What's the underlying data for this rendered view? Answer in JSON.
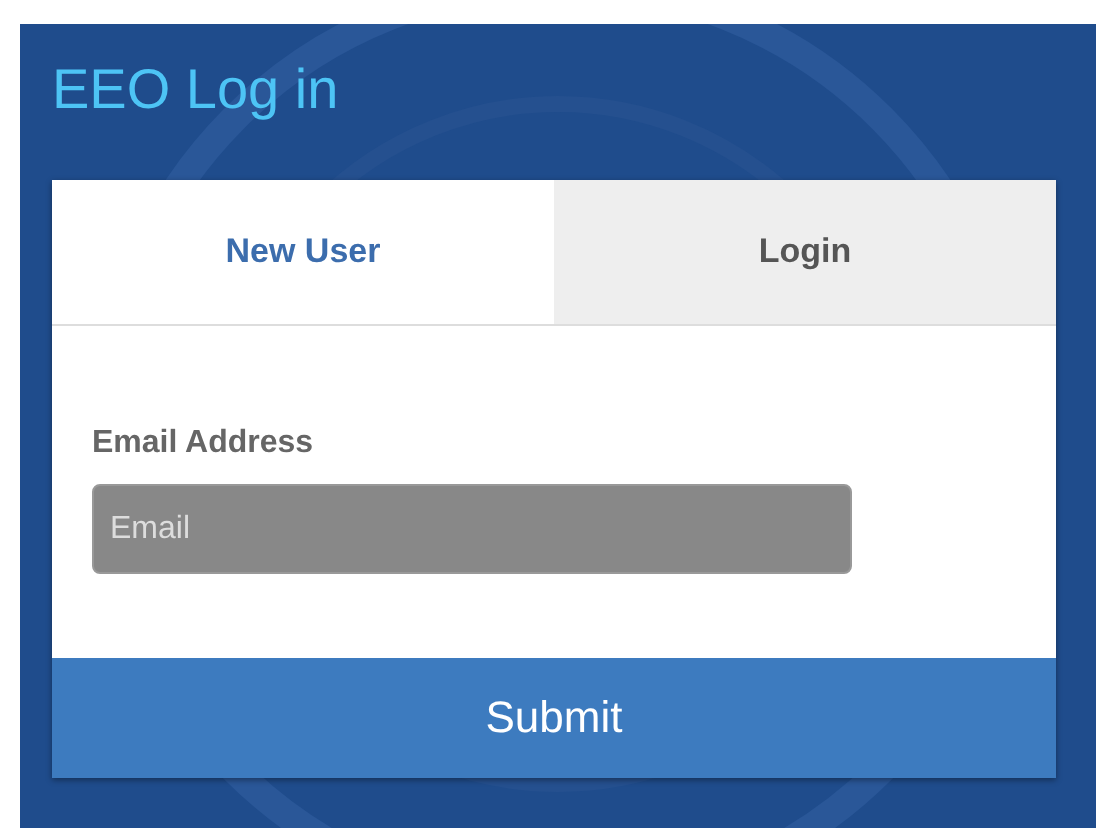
{
  "title": "EEO Log in",
  "tabs": [
    {
      "label": "New User",
      "selected": true
    },
    {
      "label": "Login",
      "selected": false
    }
  ],
  "email": {
    "label": "Email Address",
    "placeholder": "Email"
  },
  "submit": "Submit"
}
